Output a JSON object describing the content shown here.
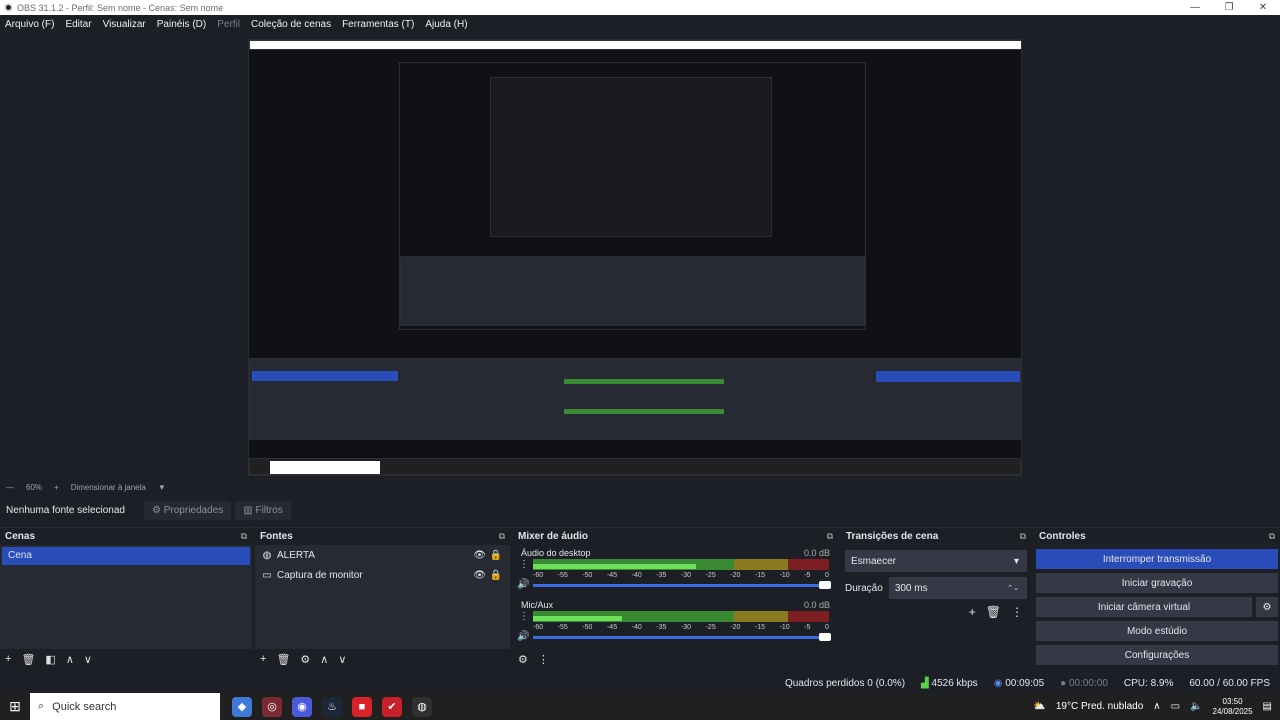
{
  "window": {
    "title": "OBS 31.1.2 - Perfil: Sem nome - Cenas: Sem nome",
    "minimize": "—",
    "maximize": "❐",
    "close": "✕"
  },
  "menu": {
    "items": [
      "Arquivo (F)",
      "Editar",
      "Visualizar",
      "Painéis (D)",
      "Perfil",
      "Coleção de cenas",
      "Ferramentas (T)",
      "Ajuda (H)"
    ]
  },
  "zoombar": {
    "minus": "—",
    "zoom": "60%",
    "plus": "+",
    "resize": "Dimensionar à janela"
  },
  "sourcebar": {
    "selected": "Nenhuma fonte selecionad",
    "properties": "Propriedades",
    "filters": "Filtros"
  },
  "scenes": {
    "title": "Cenas",
    "items": [
      "Cena"
    ]
  },
  "sources": {
    "title": "Fontes",
    "items": [
      {
        "label": "ALERTA",
        "icon": "globe-icon"
      },
      {
        "label": "Captura de monitor",
        "icon": "monitor-icon"
      }
    ]
  },
  "mixer": {
    "title": "Mixer de áudio",
    "channels": [
      {
        "name": "Áudio do desktop",
        "db": "0.0 dB",
        "level": 0.55
      },
      {
        "name": "Mic/Aux",
        "db": "0.0 dB",
        "level": 0.3
      }
    ],
    "ticks": [
      "-60",
      "-55",
      "-50",
      "-45",
      "-40",
      "-35",
      "-30",
      "-25",
      "-20",
      "-15",
      "-10",
      "-5",
      "0"
    ]
  },
  "transitions": {
    "title": "Transições de cena",
    "selected": "Esmaecer",
    "duration_label": "Duração",
    "duration_value": "300 ms"
  },
  "controls": {
    "title": "Controles",
    "buttons": [
      "Interromper transmissão",
      "Iniciar gravação",
      "Iniciar câmera virtual",
      "Modo estúdio",
      "Configurações"
    ]
  },
  "status": {
    "frames": "Quadros perdidos 0 (0.0%)",
    "bitrate": "4526 kbps",
    "stream_time": "00:09:05",
    "rec_time": "00:00:00",
    "cpu": "CPU: 8.9%",
    "fps": "60.00 / 60.00 FPS"
  },
  "taskbar": {
    "search_placeholder": "Quick search",
    "weather": "19°C  Pred. nublado",
    "time": "03:50",
    "date": "24/08/2025"
  },
  "colors": {
    "accent": "#284cb8",
    "bg": "#1d1f26",
    "panel": "#272a33"
  }
}
